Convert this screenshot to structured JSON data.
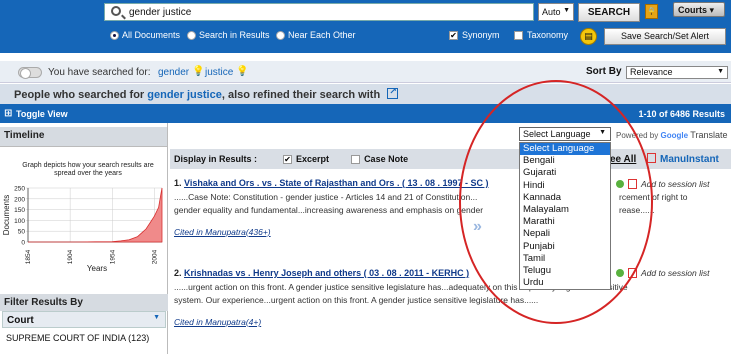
{
  "search": {
    "query": "gender justice",
    "mode": "Auto",
    "button": "SEARCH",
    "courts_label": "Courts"
  },
  "options": {
    "all_documents": "All Documents",
    "search_in_results": "Search in Results",
    "near_each_other": "Near Each Other",
    "synonym": "Synonym",
    "taxonomy": "Taxonomy",
    "save_button": "Save Search/Set Alert"
  },
  "history": {
    "label": "You have searched for:",
    "terms": [
      "gender",
      "justice"
    ],
    "sort_label": "Sort By",
    "sort_value": "Relevance"
  },
  "refine": {
    "prefix": "People who searched for",
    "term": "gender justice",
    "suffix": ", also refined their search with"
  },
  "bluebar": {
    "toggle": "Toggle View",
    "range": "1-10 of 6486 Results"
  },
  "timeline": {
    "header": "Timeline",
    "caption": "Graph depicts how your search results are spread over the years",
    "ylabel": "Documents",
    "xlabel": "Years",
    "yticks": [
      "250",
      "200",
      "150",
      "100",
      "50",
      "0"
    ],
    "xticks": [
      "1854",
      "1904",
      "1954",
      "2004"
    ]
  },
  "chart_data": {
    "type": "area",
    "ylabel": "Documents",
    "xlabel": "Years",
    "ylim": [
      0,
      250
    ],
    "x": [
      1854,
      1874,
      1894,
      1914,
      1934,
      1954,
      1964,
      1974,
      1984,
      1994,
      1999,
      2004,
      2009,
      2012,
      2013
    ],
    "values": [
      0,
      0,
      0,
      0,
      1,
      2,
      5,
      10,
      25,
      60,
      90,
      120,
      160,
      230,
      250
    ]
  },
  "display": {
    "label": "Display in Results :",
    "excerpt": "Excerpt",
    "case_note": "Case Note",
    "see_all": "ee All",
    "manu_instant": "ManuInstant"
  },
  "translate": {
    "select": "Select Language",
    "powered": "Powered by",
    "google": "Google",
    "translate": "Translate",
    "languages": [
      "Select Language",
      "Bengali",
      "Gujarati",
      "Hindi",
      "Kannada",
      "Malayalam",
      "Marathi",
      "Nepali",
      "Punjabi",
      "Tamil",
      "Telugu",
      "Urdu"
    ]
  },
  "results": [
    {
      "num": "1.",
      "title": "Vishaka and Ors . vs . State of Rajasthan and Ors . ( 13 . 08 . 1997 - SC )",
      "snip_a": "......Case Note: Constitution - gender justice - Articles 14 and 21 of Constitution...",
      "snip_a_tail": "rcement of right to",
      "snip_b": "gender equality and fundamental...increasing awareness and emphasis on gender",
      "snip_b_tail": "rease......",
      "cited": "Cited in Manupatra(436+)",
      "session": "Add to session list"
    },
    {
      "num": "2.",
      "title": "Krishnadas vs . Henry Joseph and others ( 03 . 08 . 2011 - KERHC )",
      "snip_a": "......urgent action on this front. A gender justice sensitive legislature has...adequately on this aspect by a gender sensitive",
      "snip_b": "system. Our experience...urgent action on this front. A gender justice sensitive legislature has......",
      "cited": "Cited in Manupatra(4+)",
      "session": "Add to session list"
    }
  ],
  "filter": {
    "header": "Filter Results By",
    "court_label": "Court",
    "first_court": "SUPREME COURT OF INDIA (123)"
  }
}
